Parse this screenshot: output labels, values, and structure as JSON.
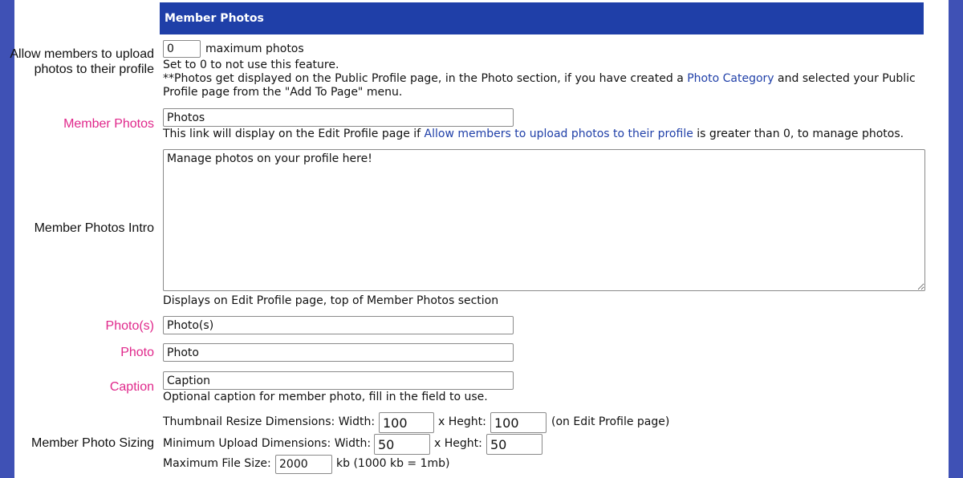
{
  "section": {
    "title": "Member Photos"
  },
  "max_photos": {
    "label": "Allow members to upload photos to their profile",
    "value": "0",
    "suffix": "maximum photos",
    "help1": "Set to 0 to not use this feature.",
    "help2_a": "**Photos get displayed on the Public Profile page, in the Photo section, if you have created a ",
    "help2_link": "Photo Category",
    "help2_b": " and selected your Public",
    "help3": "Profile page from the \"Add To Page\" menu."
  },
  "member_photos": {
    "label": "Member Photos",
    "value": "Photos",
    "help_a": "This link will display on the Edit Profile page if ",
    "help_link": "Allow members to upload photos to their profile",
    "help_b": " is greater than 0, to manage photos."
  },
  "intro": {
    "label": "Member Photos Intro",
    "value": "Manage photos on your profile here!",
    "help": "Displays on Edit Profile page, top of Member Photos section"
  },
  "photos_plural": {
    "label": "Photo(s)",
    "value": "Photo(s)"
  },
  "photo_single": {
    "label": "Photo",
    "value": "Photo"
  },
  "caption": {
    "label": "Caption",
    "value": "Caption",
    "help": "Optional caption for member photo, fill in the field to use."
  },
  "sizing": {
    "label": "Member Photo Sizing",
    "thumb_label": "Thumbnail Resize Dimensions: Width:",
    "thumb_width": "100",
    "thumb_height_label": "x Heght:",
    "thumb_height": "100",
    "thumb_note": "(on Edit Profile page)",
    "min_label": "Minimum Upload Dimensions: Width:",
    "min_width": "50",
    "min_height_label": "x Heght:",
    "min_height": "50",
    "max_label": "Maximum File Size:",
    "max_size": "2000",
    "max_note": "kb (1000 kb = 1mb)"
  }
}
